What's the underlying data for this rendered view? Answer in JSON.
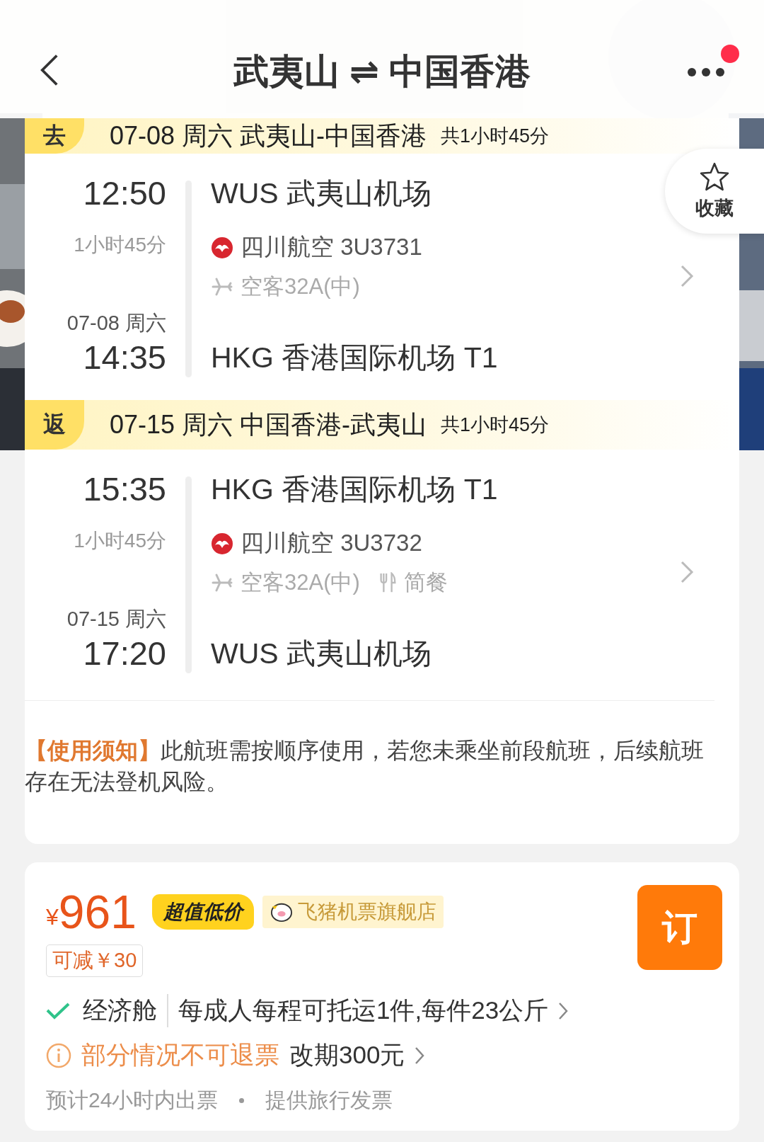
{
  "header": {
    "title": "武夷山 ⇌ 中国香港",
    "notification": true
  },
  "favorite": {
    "label": "收藏",
    "selected": false
  },
  "legs": [
    {
      "badge": "去",
      "summary": "07-08 周六 武夷山-中国香港",
      "total": "共1小时45分",
      "depart_time": "12:50",
      "duration": "1小时45分",
      "arrive_date": "07-08 周六",
      "arrive_time": "14:35",
      "origin": "WUS 武夷山机场",
      "airline": "四川航空 3U3731",
      "aircraft": "空客32A(中)",
      "destination": "HKG 香港国际机场 T1"
    },
    {
      "badge": "返",
      "summary": "07-15 周六 中国香港-武夷山",
      "total": "共1小时45分",
      "depart_time": "15:35",
      "duration": "1小时45分",
      "arrive_date": "07-15 周六",
      "arrive_time": "17:20",
      "origin": "HKG 香港国际机场 T1",
      "airline": "四川航空 3U3732",
      "aircraft": "空客32A(中)",
      "meal": "简餐",
      "destination": "WUS 武夷山机场"
    }
  ],
  "notice": "**【使用须知】**此航班需按顺序使用，若您未乘坐前段航班，后续航班存在无法登机风险。",
  "offer": {
    "price_symbol": "¥",
    "price": "961",
    "tag": "超值低价",
    "shop": "飞猪机票旗舰店",
    "discount": "可减￥30",
    "book": "订",
    "cabin": "经济舱",
    "baggage": "每成人每程可托运1件,每件23公斤",
    "refund_warning": "部分情况不可退票",
    "change_fee": "改期300元",
    "notes": [
      "预计24小时内出票",
      "提供旅行发票"
    ]
  }
}
